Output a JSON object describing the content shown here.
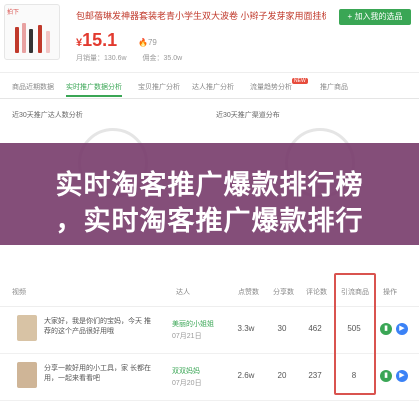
{
  "product": {
    "promo_text": "拍下",
    "title": "包邮蓓琳发神器套装老青小学生双大波卷 小辫子发芽家用面挂梳头发",
    "add_button": "+ 加入我的选品",
    "price_symbol": "¥",
    "price": "15.1",
    "hot_value": "79",
    "stats": [
      "月销量：130.6w",
      "佣金：35.0w"
    ]
  },
  "tabs": [
    "商品近期数据",
    "实时推广数据分析",
    "宝贝推广分析",
    "达人推广分析",
    "流量趋势分析",
    "推广商品"
  ],
  "tabs_active": 1,
  "new_badge": "NEW",
  "charts": {
    "left_title": "近30天推广达人数分析",
    "right_title": "近30天推广渠道分布"
  },
  "banner": {
    "line1": "实时淘客推广爆款排行榜",
    "line2": "，实时淘客推广爆款排行"
  },
  "table": {
    "headers": [
      "视频",
      "达人",
      "点赞数",
      "分享数",
      "评论数",
      "引流商品",
      "操作"
    ],
    "rows": [
      {
        "text": "大家好，我是你们的宝妈，今天 推荐的这个产品很好用哦",
        "account": "美丽的小姐姐",
        "date": "07月21日",
        "likes": "3.3w",
        "shares": "30",
        "comments": "462",
        "goods": "505"
      },
      {
        "text": "分享一款好用的小工具，家 长都在用，一起来看看吧",
        "account": "双双妈妈",
        "date": "07月20日",
        "likes": "2.6w",
        "shares": "20",
        "comments": "237",
        "goods": "8"
      }
    ]
  }
}
